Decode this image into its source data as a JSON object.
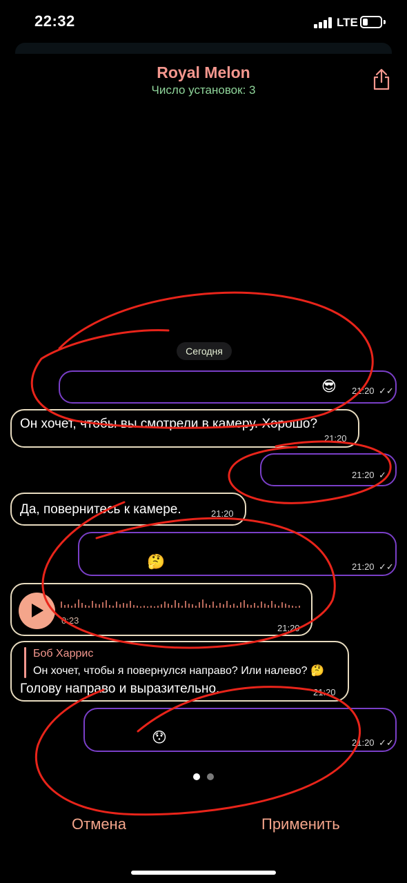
{
  "status_bar": {
    "time": "22:32",
    "network": "LTE"
  },
  "header": {
    "title": "Royal Melon",
    "subtitle": "Число установок: 3"
  },
  "date_chip": "Сегодня",
  "messages": [
    {
      "direction": "out",
      "text": "",
      "emoji": "😎",
      "time": "21:20",
      "ticks": "✓✓"
    },
    {
      "direction": "in",
      "text": "Он хочет, чтобы вы смотрели в камеру. Хорошо?",
      "time": "21:20"
    },
    {
      "direction": "out",
      "text": "",
      "time": "21:20",
      "ticks": "✓"
    },
    {
      "direction": "in",
      "text": "Да, повернитесь к камере.",
      "time": "21:20"
    },
    {
      "direction": "out",
      "text": "",
      "emoji": "🤔",
      "time": "21:20",
      "ticks": "✓✓"
    },
    {
      "direction": "in",
      "type": "voice",
      "duration": "0:23",
      "time": "21:20"
    },
    {
      "direction": "in",
      "reply_to": {
        "name": "Боб Харрис",
        "text": "Он хочет, чтобы я повернулся направо? Или налево? 🤔"
      },
      "text": "Голову направо и выразительно.",
      "time": "21:20"
    },
    {
      "direction": "out",
      "text": "",
      "emoji": "😯",
      "time": "21:20",
      "ticks": "✓✓"
    }
  ],
  "pager": {
    "pages": 2,
    "active": 1
  },
  "actions": {
    "cancel": "Отмена",
    "apply": "Применить"
  },
  "colors": {
    "accent": "#f4978e",
    "subtitle": "#8fd59a",
    "outgoing_border": "#7a3fc8",
    "incoming_border": "#e8dcc0",
    "annotation": "#e8241a"
  }
}
